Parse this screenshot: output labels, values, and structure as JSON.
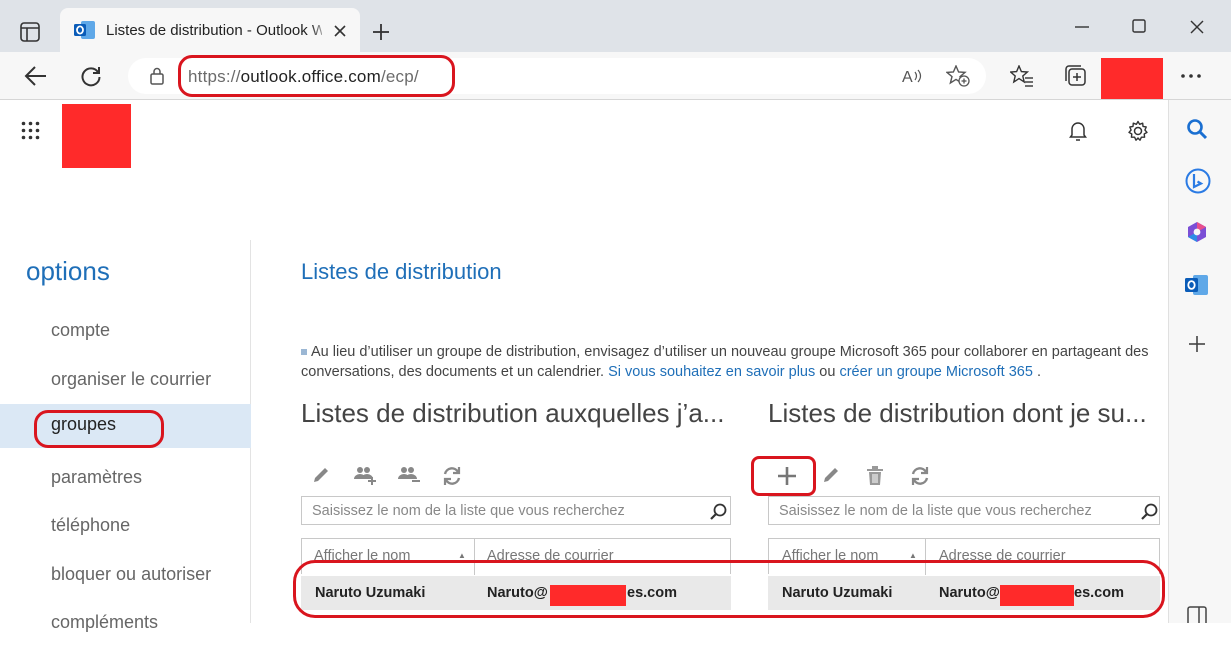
{
  "browser": {
    "tab_title": "Listes de distribution - Outlook W",
    "url_prefix": "https://",
    "url_host": "outlook.office.com",
    "url_path": "/ecp/"
  },
  "nav": {
    "title": "options",
    "items": [
      {
        "label": "compte"
      },
      {
        "label": "organiser le courrier"
      },
      {
        "label": "groupes"
      },
      {
        "label": "paramètres"
      },
      {
        "label": "téléphone"
      },
      {
        "label": "bloquer ou autoriser"
      },
      {
        "label": "compléments"
      }
    ]
  },
  "main": {
    "title": "Listes de distribution",
    "info_text": "Au lieu d’utiliser un groupe de distribution, envisagez d’utiliser un nouveau groupe Microsoft 365 pour collaborer en partageant des conversations, des documents et un calendrier.",
    "info_link1": "Si vous souhaitez en savoir plus",
    "info_ou": "ou",
    "info_link2": "créer un groupe Microsoft 365",
    "info_end": ".",
    "left_section": {
      "title": "Listes de distribution auxquelles j’a...",
      "search_placeholder": "Saisissez le nom de la liste que vous recherchez",
      "col_name": "Afficher le nom",
      "col_email": "Adresse de courrier",
      "row_name": "Naruto Uzumaki",
      "row_email_start": "Naruto@",
      "row_email_end": "es.com"
    },
    "right_section": {
      "title": "Listes de distribution dont je su...",
      "search_placeholder": "Saisissez le nom de la liste que vous recherchez",
      "col_name": "Afficher le nom",
      "col_email": "Adresse de courrier",
      "row_name": "Naruto Uzumaki",
      "row_email_start": "Naruto@",
      "row_email_end": "es.com"
    }
  },
  "colors": {
    "accent": "#1f6fb8",
    "annotation": "#d9151e",
    "redaction": "#ff2a2a"
  }
}
